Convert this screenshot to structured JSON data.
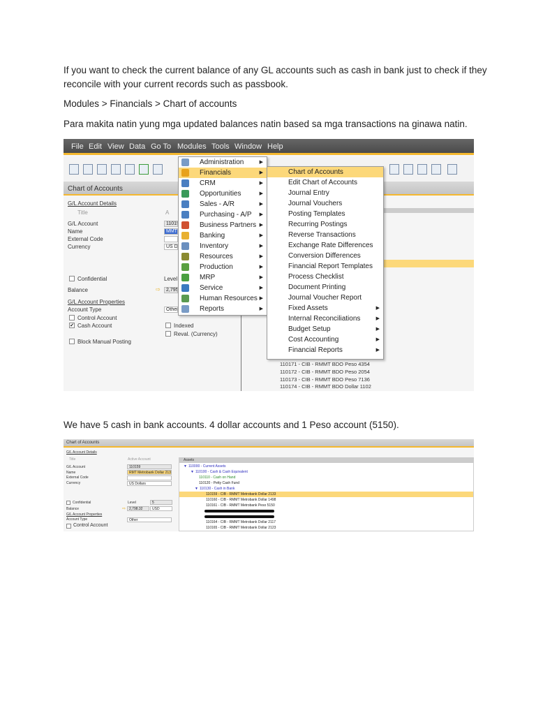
{
  "doc": {
    "para1_line1": "If you want to check the current balance of any GL accounts such as cash in bank just to check if they",
    "para1_line2": "reconcile with your current records such as passbook.",
    "para2": "Modules > Financials > Chart of accounts",
    "para3": "Para makita natin yung mga updated balances natin based sa mga transactions na ginawa natin.",
    "para4": "We have 5 cash in bank accounts. 4 dollar accounts and 1 Peso account (5150)."
  },
  "shot1": {
    "menubar": [
      "File",
      "Edit",
      "View",
      "Data",
      "Go To",
      "Modules",
      "Tools",
      "Window",
      "Help"
    ],
    "window_title": "Chart of Accounts",
    "form": {
      "details_heading": "G/L Account Details",
      "title_radio": "Title",
      "active_radio": "A",
      "gl_account_label": "G/L Account",
      "gl_account_value": "11015",
      "name_label": "Name",
      "name_value": "MMT",
      "external_code_label": "External Code",
      "currency_label": "Currency",
      "currency_value": "US Do",
      "confidential": "Confidential",
      "level_label": "Level",
      "balance_label": "Balance",
      "balance_value": "2,795.",
      "properties_heading": "G/L Account Properties",
      "account_type_label": "Account Type",
      "account_type_value": "Other",
      "control_account": "Control Account",
      "cash_account": "Cash Account",
      "indexed": "Indexed",
      "reval": "Reval. (Currency)",
      "block_manual": "Block Manual Posting"
    },
    "modules_menu": [
      {
        "label": "Administration",
        "color": "#7a9cc6"
      },
      {
        "label": "Financials",
        "color": "#e8a21a"
      },
      {
        "label": "CRM",
        "color": "#4a7fc1"
      },
      {
        "label": "Opportunities",
        "color": "#3a9a5a"
      },
      {
        "label": "Sales - A/R",
        "color": "#4a7fc1"
      },
      {
        "label": "Purchasing - A/P",
        "color": "#4a7fc1"
      },
      {
        "label": "Business Partners",
        "color": "#d05030"
      },
      {
        "label": "Banking",
        "color": "#e8b030"
      },
      {
        "label": "Inventory",
        "color": "#6a8fbf"
      },
      {
        "label": "Resources",
        "color": "#8a8a30"
      },
      {
        "label": "Production",
        "color": "#5aa040"
      },
      {
        "label": "MRP",
        "color": "#4aa040"
      },
      {
        "label": "Service",
        "color": "#3a7ac0"
      },
      {
        "label": "Human Resources",
        "color": "#5a9a50"
      },
      {
        "label": "Reports",
        "color": "#7a9cc6"
      }
    ],
    "financials_menu": [
      {
        "label": "Chart of Accounts",
        "sub": false
      },
      {
        "label": "Edit Chart of Accounts",
        "sub": false
      },
      {
        "label": "Journal Entry",
        "sub": false
      },
      {
        "label": "Journal Vouchers",
        "sub": false
      },
      {
        "label": "Posting Templates",
        "sub": false
      },
      {
        "label": "Recurring Postings",
        "sub": false
      },
      {
        "label": "Reverse Transactions",
        "sub": false
      },
      {
        "label": "Exchange Rate Differences",
        "sub": false
      },
      {
        "label": "Conversion Differences",
        "sub": false
      },
      {
        "label": "Financial Report Templates",
        "sub": false
      },
      {
        "label": "Process Checklist",
        "sub": false
      },
      {
        "label": "Document Printing",
        "sub": false
      },
      {
        "label": "Journal Voucher Report",
        "sub": false
      },
      {
        "label": "Fixed Assets",
        "sub": true
      },
      {
        "label": "Internal Reconciliations",
        "sub": true
      },
      {
        "label": "Budget Setup",
        "sub": true
      },
      {
        "label": "Cost Accounting",
        "sub": true
      },
      {
        "label": "Financial Reports",
        "sub": true
      }
    ],
    "accounts_below": [
      "110171 - CIB - RMMT BDO Peso 4354",
      "110172 - CIB - RMMT BDO Peso 2054",
      "110173 - CIB - RMMT BDO Peso 7136",
      "110174 - CIB - RMMT BDO Dollar 1102"
    ]
  },
  "shot2": {
    "window_title": "Chart of Accounts",
    "details_heading": "G/L Account Details",
    "title_radio": "Title",
    "active_radio": "Active Account",
    "gl_account_label": "G/L Account",
    "gl_account_value": "110159",
    "name_label": "Name",
    "name_value": "RMT Metrobank Dollar 2133",
    "external_code_label": "External Code",
    "currency_label": "Currency",
    "currency_value": "US Dollars",
    "confidential": "Confidential",
    "level_label": "Level",
    "level_value": "5",
    "balance_label": "Balance",
    "balance_value": "2,798.32",
    "balance_currency": "USD",
    "properties_heading": "G/L Account Properties",
    "account_type_label": "Account Type",
    "account_type_value": "Other",
    "control_account": "Control Account",
    "tree_header": "Assets",
    "tree": [
      {
        "label": "110000 - Current Assets",
        "color": "#3030c0",
        "indent": 0,
        "exp": "▼"
      },
      {
        "label": "110100 - Cash & Cash Equivalent",
        "color": "#3030c0",
        "indent": 1,
        "exp": "▼"
      },
      {
        "label": "110110 - Cash on Hand",
        "color": "#2a8a2a",
        "indent": 2,
        "exp": ""
      },
      {
        "label": "110120 - Petty Cash Fund",
        "color": "#222",
        "indent": 2,
        "exp": ""
      },
      {
        "label": "110130 - Cash in Bank",
        "color": "#3030c0",
        "indent": 1.6,
        "exp": "▼"
      },
      {
        "label": "110159 - CIB - RMMT Metrobank Dollar 2133",
        "color": "#222",
        "indent": 3,
        "exp": "",
        "hl": true
      },
      {
        "label": "110160 - CIB - RMMT Metrobank Dollar 1498",
        "color": "#222",
        "indent": 3,
        "exp": ""
      },
      {
        "label": "110161 - CIB - RMMT Metrobank Peso 5150",
        "color": "#222",
        "indent": 3,
        "exp": ""
      },
      {
        "label": "",
        "color": "#222",
        "indent": 3,
        "exp": "",
        "redacted": true
      },
      {
        "label": "",
        "color": "#222",
        "indent": 3,
        "exp": "",
        "redacted": true
      },
      {
        "label": "110164 - CIB - RMMT Metrobank Dollar 2117",
        "color": "#222",
        "indent": 3,
        "exp": ""
      },
      {
        "label": "110165 - CIB - RMMT Metrobank Dollar 2123",
        "color": "#222",
        "indent": 3,
        "exp": ""
      }
    ]
  }
}
